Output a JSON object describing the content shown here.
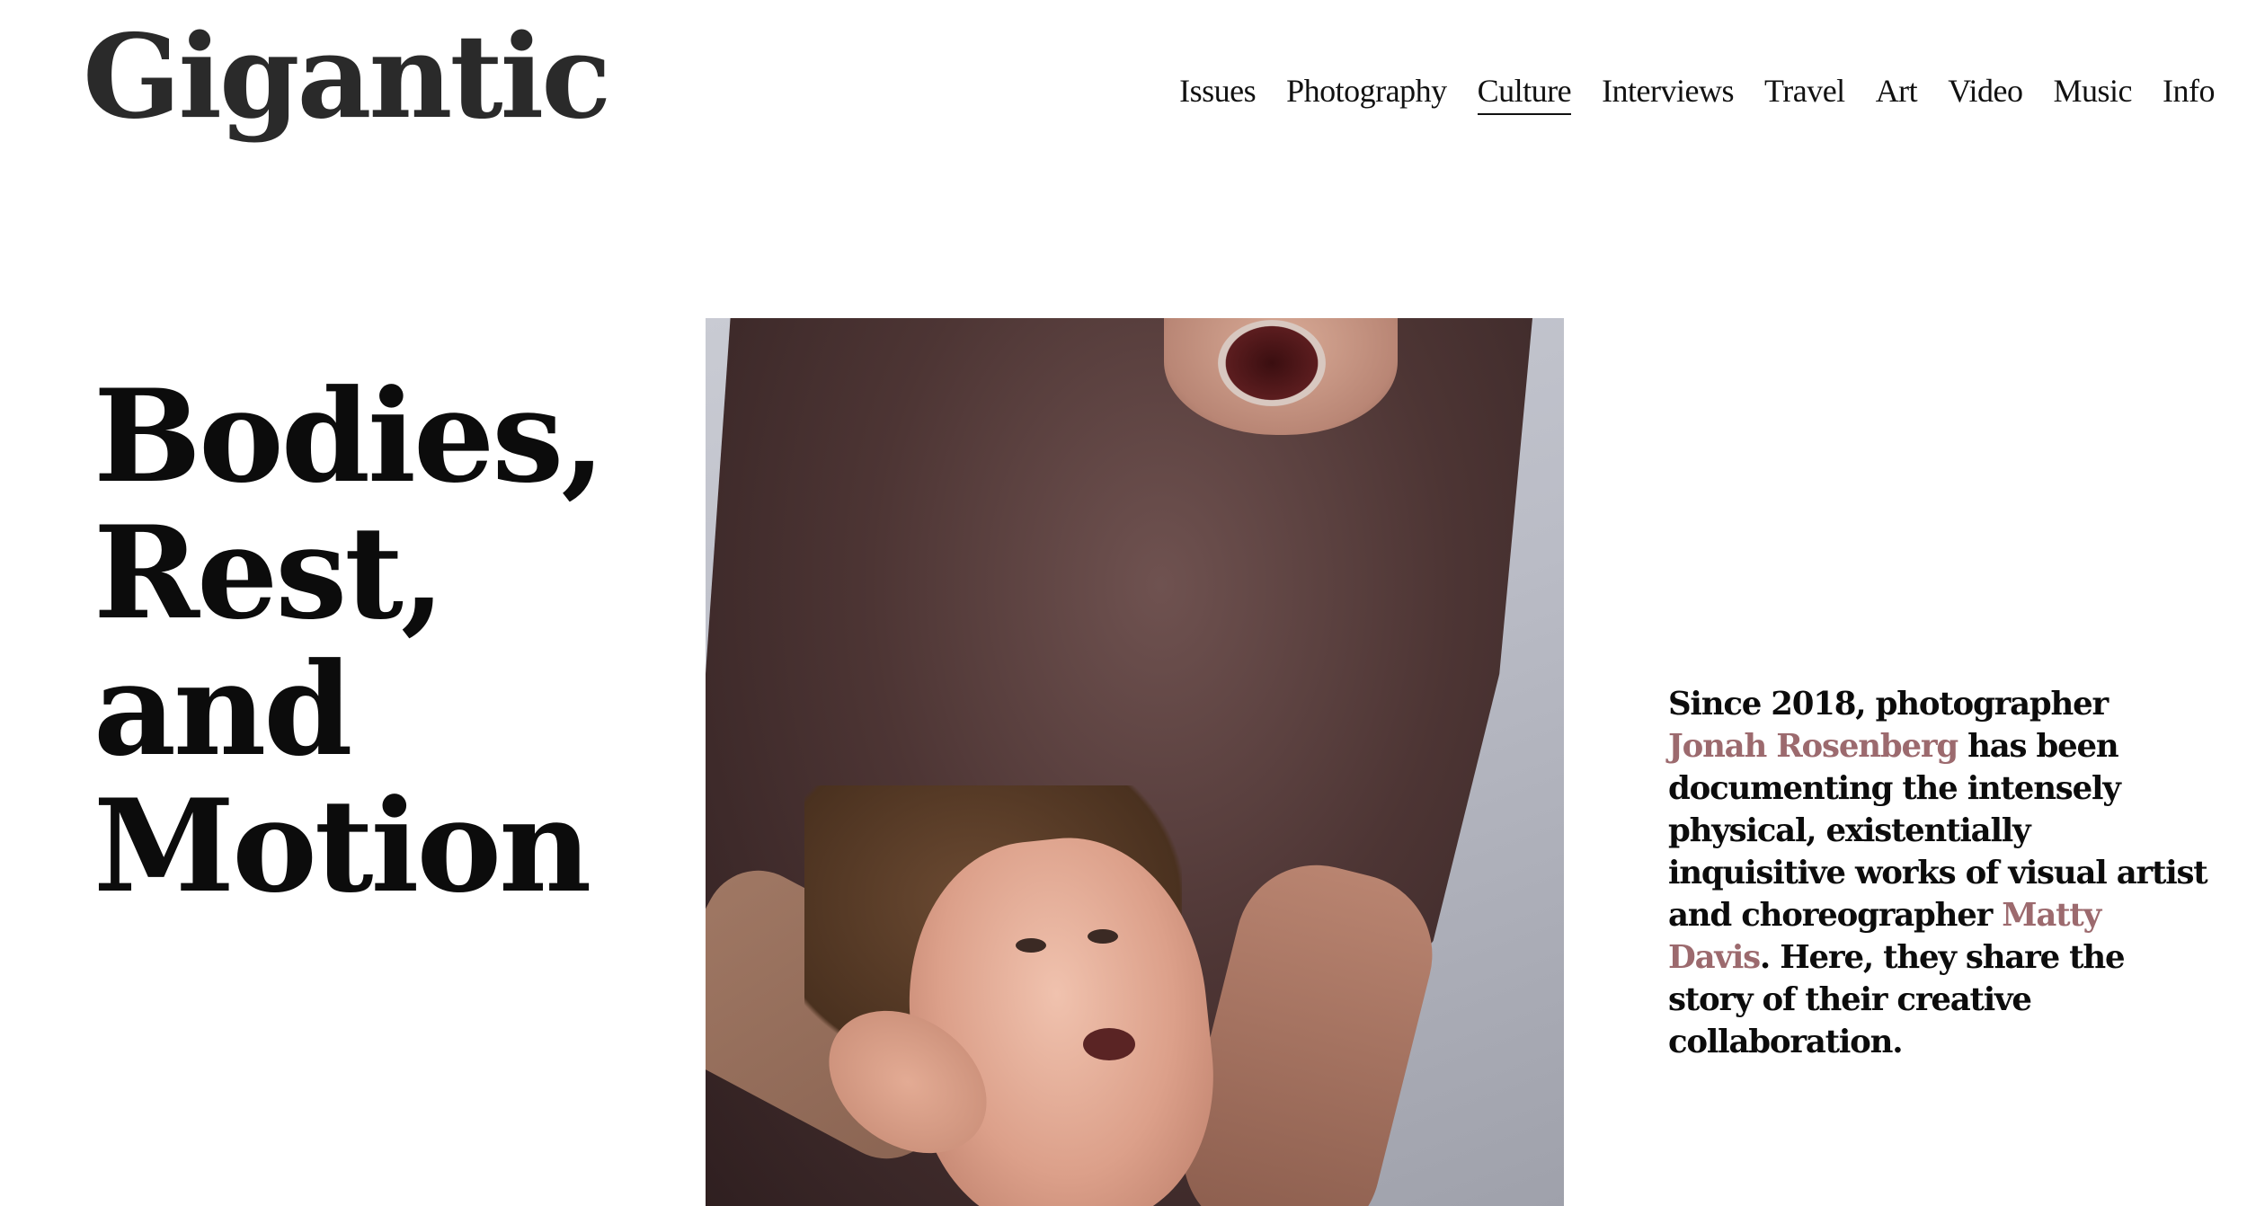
{
  "site": {
    "logo_text": "Gigantic"
  },
  "nav": {
    "items": [
      {
        "label": "Issues"
      },
      {
        "label": "Photography"
      },
      {
        "label": "Culture",
        "active": true
      },
      {
        "label": "Interviews"
      },
      {
        "label": "Travel"
      },
      {
        "label": "Art"
      },
      {
        "label": "Video"
      },
      {
        "label": "Music"
      },
      {
        "label": "Info"
      }
    ]
  },
  "article": {
    "headline_line1": "Bodies,",
    "headline_line2": "Rest, and",
    "headline_line3": "Motion",
    "hero_image": "photo of two men, one in a brown t-shirt shouting above, another with long hair looking up, a hand on his neck",
    "intro": {
      "text_1": "Since 2018, photographer ",
      "link_1": "Jonah Rosenberg",
      "text_2": " has been documenting the intensely physical, existentially inquisitive works of visual artist and choreographer ",
      "link_2": "Matty Davis",
      "text_3": ". Here, they share the story of their creative collaboration."
    }
  },
  "colors": {
    "link_accent": "#9c6a6e",
    "text": "#0c0c0c",
    "background": "#ffffff"
  }
}
